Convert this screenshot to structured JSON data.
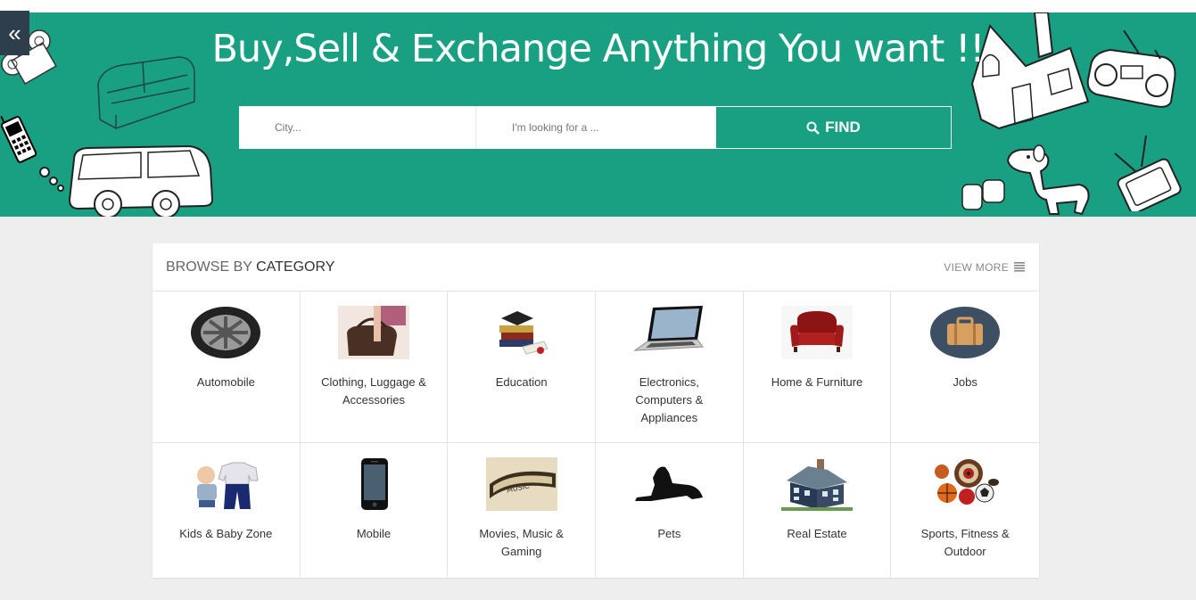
{
  "hero": {
    "title": "Buy,Sell & Exchange Anything You want !!",
    "bg_color": "#19a082"
  },
  "sidebar": {
    "toggle_icon": "double-chevron-left-icon"
  },
  "search": {
    "city_placeholder": "City...",
    "query_placeholder": "I'm looking for a ...",
    "find_label": "FIND"
  },
  "categories_panel": {
    "title_light": "BROWSE BY",
    "title_bold": "CATEGORY",
    "view_more": "VIEW MORE",
    "items": [
      {
        "label": "Automobile",
        "icon": "tire-icon"
      },
      {
        "label": "Clothing, Luggage & Accessories",
        "icon": "handbag-icon"
      },
      {
        "label": "Education",
        "icon": "books-icon"
      },
      {
        "label": "Electronics, Computers & Appliances",
        "icon": "laptop-icon"
      },
      {
        "label": "Home & Furniture",
        "icon": "armchair-icon"
      },
      {
        "label": "Jobs",
        "icon": "briefcase-icon"
      },
      {
        "label": "Kids & Baby Zone",
        "icon": "baby-clothes-icon"
      },
      {
        "label": "Mobile",
        "icon": "phone-icon"
      },
      {
        "label": "Movies, Music & Gaming",
        "icon": "film-strip-icon"
      },
      {
        "label": "Pets",
        "icon": "dog-icon"
      },
      {
        "label": "Real Estate",
        "icon": "house-icon"
      },
      {
        "label": "Sports, Fitness & Outdoor",
        "icon": "sports-balls-icon"
      }
    ]
  }
}
